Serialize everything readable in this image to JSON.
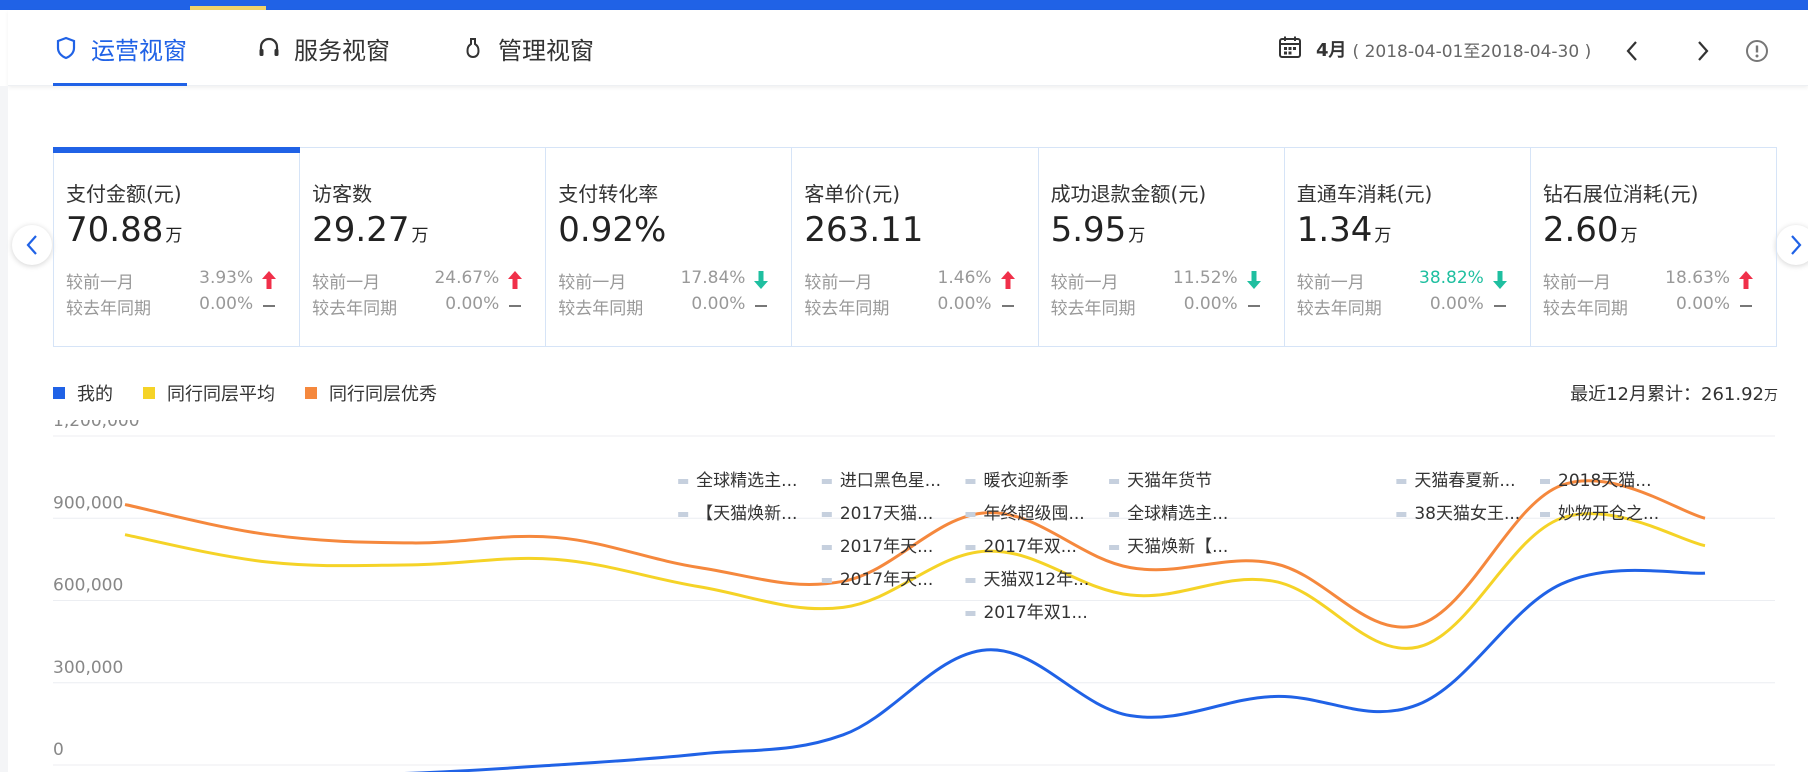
{
  "nav": {
    "tabs": [
      {
        "label": "运营视窗",
        "icon": "shield-icon",
        "active": true
      },
      {
        "label": "服务视窗",
        "icon": "headset-icon",
        "active": false
      },
      {
        "label": "管理视窗",
        "icon": "bottle-icon",
        "active": false
      }
    ],
    "month": "4月",
    "range": "( 2018-04-01至2018-04-30 )"
  },
  "kpis": [
    {
      "title": "支付金额(元)",
      "value": "70.88",
      "unit": "万",
      "mom_label": "较前一月",
      "mom_pct": "3.93%",
      "mom_dir": "up",
      "yoy_label": "较去年同期",
      "yoy_pct": "0.00%",
      "yoy_dir": "flat"
    },
    {
      "title": "访客数",
      "value": "29.27",
      "unit": "万",
      "mom_label": "较前一月",
      "mom_pct": "24.67%",
      "mom_dir": "up",
      "yoy_label": "较去年同期",
      "yoy_pct": "0.00%",
      "yoy_dir": "flat"
    },
    {
      "title": "支付转化率",
      "value": "0.92%",
      "unit": "",
      "mom_label": "较前一月",
      "mom_pct": "17.84%",
      "mom_dir": "down",
      "yoy_label": "较去年同期",
      "yoy_pct": "0.00%",
      "yoy_dir": "flat"
    },
    {
      "title": "客单价(元)",
      "value": "263.11",
      "unit": "",
      "mom_label": "较前一月",
      "mom_pct": "1.46%",
      "mom_dir": "up",
      "yoy_label": "较去年同期",
      "yoy_pct": "0.00%",
      "yoy_dir": "flat"
    },
    {
      "title": "成功退款金额(元)",
      "value": "5.95",
      "unit": "万",
      "mom_label": "较前一月",
      "mom_pct": "11.52%",
      "mom_dir": "down",
      "yoy_label": "较去年同期",
      "yoy_pct": "0.00%",
      "yoy_dir": "flat"
    },
    {
      "title": "直通车消耗(元)",
      "value": "1.34",
      "unit": "万",
      "mom_label": "较前一月",
      "mom_pct": "38.82%",
      "mom_dir": "down",
      "mom_teal": true,
      "yoy_label": "较去年同期",
      "yoy_pct": "0.00%",
      "yoy_dir": "flat"
    },
    {
      "title": "钻石展位消耗(元)",
      "value": "2.60",
      "unit": "万",
      "mom_label": "较前一月",
      "mom_pct": "18.63%",
      "mom_dir": "up",
      "yoy_label": "较去年同期",
      "yoy_pct": "0.00%",
      "yoy_dir": "flat"
    }
  ],
  "colors": {
    "accent": "#2062e6",
    "up": "#f0304a",
    "down": "#1fbfa0",
    "series_mine": "#2062e6",
    "series_avg": "#f5d327",
    "series_best": "#f5883d",
    "event_marker": "#c6d0de"
  },
  "cumulative": {
    "label": "最近12月累计：",
    "value": "261.92",
    "unit": "万"
  },
  "chart_data": {
    "type": "line",
    "y_ticks": [
      "1,200,000",
      "900,000",
      "600,000",
      "300,000",
      "0"
    ],
    "ylim": [
      0,
      1200000
    ],
    "x": [
      1,
      2,
      3,
      4,
      5,
      6,
      7,
      8,
      9,
      10,
      11,
      12
    ],
    "legend_position": "top-left",
    "grid": true,
    "series": [
      {
        "name": "我的",
        "color": "#2062e6",
        "values": [
          -60000,
          -40000,
          -30000,
          0,
          40000,
          110000,
          420000,
          180000,
          250000,
          220000,
          660000,
          700000
        ]
      },
      {
        "name": "同行同层平均",
        "color": "#f5d327",
        "values": [
          840000,
          740000,
          730000,
          750000,
          650000,
          575000,
          780000,
          620000,
          670000,
          430000,
          900000,
          800000
        ]
      },
      {
        "name": "同行同层优秀",
        "color": "#f5883d",
        "values": [
          950000,
          840000,
          810000,
          830000,
          720000,
          670000,
          920000,
          720000,
          735000,
          510000,
          1020000,
          900000
        ]
      }
    ],
    "annotations": [
      {
        "x": 6,
        "y_rank": 0,
        "text": "全球精选主..."
      },
      {
        "x": 6,
        "y_rank": 1,
        "text": "【天猫焕新..."
      },
      {
        "x": 7,
        "y_rank": 0,
        "text": "进口黑色星..."
      },
      {
        "x": 7,
        "y_rank": 1,
        "text": "2017天猫..."
      },
      {
        "x": 7,
        "y_rank": 2,
        "text": "2017年天..."
      },
      {
        "x": 7,
        "y_rank": 3,
        "text": "2017年天..."
      },
      {
        "x": 8,
        "y_rank": 0,
        "text": "暖衣迎新季"
      },
      {
        "x": 8,
        "y_rank": 1,
        "text": "年终超级囤..."
      },
      {
        "x": 8,
        "y_rank": 2,
        "text": "2017年双..."
      },
      {
        "x": 8,
        "y_rank": 3,
        "text": "天猫双12年..."
      },
      {
        "x": 8,
        "y_rank": 4,
        "text": "2017年双1..."
      },
      {
        "x": 9,
        "y_rank": 0,
        "text": "天猫年货节"
      },
      {
        "x": 9,
        "y_rank": 1,
        "text": "全球精选主..."
      },
      {
        "x": 9,
        "y_rank": 2,
        "text": "天猫焕新【..."
      },
      {
        "x": 11,
        "y_rank": 0,
        "text": "天猫春夏新..."
      },
      {
        "x": 11,
        "y_rank": 1,
        "text": "38天猫女王..."
      },
      {
        "x": 12,
        "y_rank": 0,
        "text": "2018天猫..."
      },
      {
        "x": 12,
        "y_rank": 1,
        "text": "妙物开仓之..."
      }
    ]
  }
}
